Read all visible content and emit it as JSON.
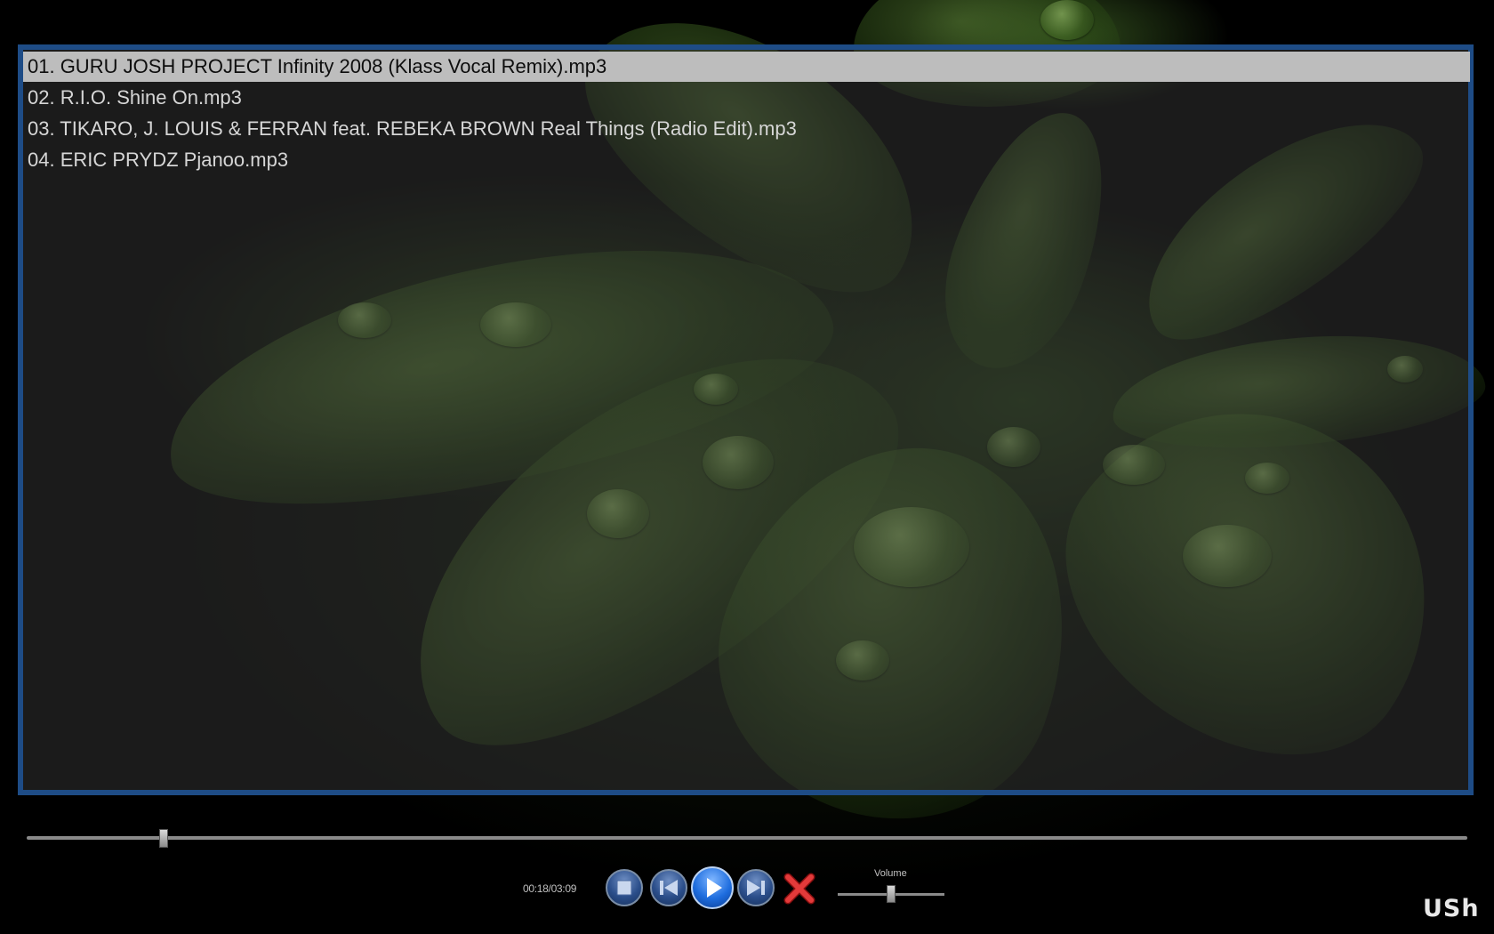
{
  "playlist": {
    "tracks": [
      {
        "label": "01. GURU JOSH PROJECT Infinity 2008 (Klass Vocal Remix).mp3",
        "selected": true
      },
      {
        "label": "02. R.I.O. Shine On.mp3",
        "selected": false
      },
      {
        "label": "03. TIKARO, J. LOUIS & FERRAN feat. REBEKA BROWN Real Things (Radio Edit).mp3",
        "selected": false
      },
      {
        "label": "04. ERIC PRYDZ Pjanoo.mp3",
        "selected": false
      }
    ]
  },
  "player": {
    "time": "00:18/03:09",
    "seek_fraction": 0.095,
    "volume_label": "Volume",
    "volume_fraction": 0.5
  },
  "controls": {
    "stop_icon": "stop-icon",
    "previous_icon": "previous-icon",
    "play_icon": "play-icon",
    "next_icon": "next-icon",
    "close_icon": "close-icon"
  },
  "brand": {
    "logo_text": "USh"
  },
  "colors": {
    "playlist_border": "#1e4c86",
    "selected_row": "#bdbdbd",
    "button_blue": "#2b4e8a",
    "close_red": "#d41f1f"
  }
}
